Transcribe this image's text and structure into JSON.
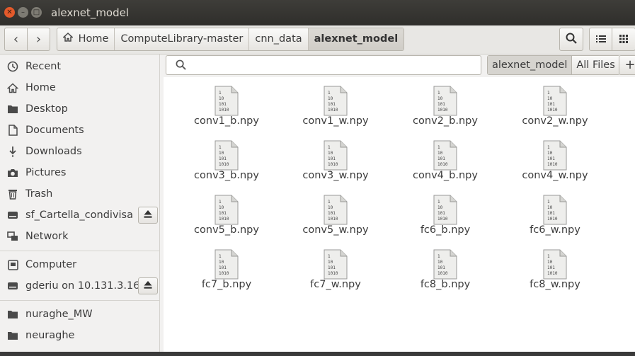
{
  "window": {
    "title": "alexnet_model"
  },
  "toolbar": {
    "back": "‹",
    "forward": "›",
    "breadcrumbs": [
      {
        "label": "Home"
      },
      {
        "label": "ComputeLibrary-master"
      },
      {
        "label": "cnn_data"
      },
      {
        "label": "alexnet_model"
      }
    ]
  },
  "sidebar": {
    "items": [
      {
        "label": "Recent",
        "icon": "clock-icon"
      },
      {
        "label": "Home",
        "icon": "home-icon"
      },
      {
        "label": "Desktop",
        "icon": "folder-icon"
      },
      {
        "label": "Documents",
        "icon": "document-icon"
      },
      {
        "label": "Downloads",
        "icon": "download-icon"
      },
      {
        "label": "Pictures",
        "icon": "camera-icon"
      },
      {
        "label": "Trash",
        "icon": "trash-icon"
      },
      {
        "label": "sf_Cartella_condivisa",
        "icon": "drive-icon"
      },
      {
        "label": "Network",
        "icon": "network-icon"
      },
      {
        "label": "Computer",
        "icon": "computer-icon"
      },
      {
        "label": "gderiu on 10.131.3.16",
        "icon": "drive-icon"
      },
      {
        "label": "nuraghe_MW",
        "icon": "folder-icon"
      },
      {
        "label": "neuraghe",
        "icon": "folder-icon"
      }
    ]
  },
  "search": {
    "scope_current": "alexnet_model",
    "scope_all": "All Files",
    "add": "+"
  },
  "files": [
    "conv1_b.npy",
    "conv1_w.npy",
    "conv2_b.npy",
    "conv2_w.npy",
    "conv3_b.npy",
    "conv3_w.npy",
    "conv4_b.npy",
    "conv4_w.npy",
    "conv5_b.npy",
    "conv5_w.npy",
    "fc6_b.npy",
    "fc6_w.npy",
    "fc7_b.npy",
    "fc7_w.npy",
    "fc8_b.npy",
    "fc8_w.npy"
  ],
  "file_icon_lines": [
    "1",
    "10",
    "101",
    "1010"
  ]
}
